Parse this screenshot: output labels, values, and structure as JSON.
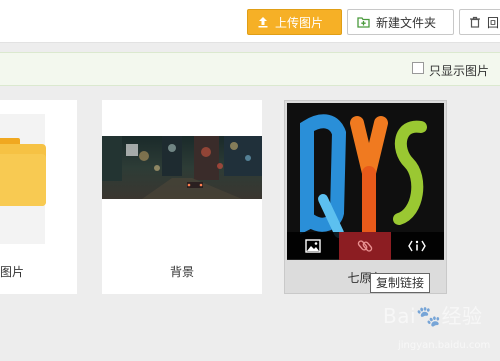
{
  "toolbar": {
    "upload_label": "上传图片",
    "new_folder_label": "新建文件夹",
    "more_label": "回"
  },
  "filter": {
    "show_images_only_label": "只显示图片",
    "show_images_only_checked": false
  },
  "cards": [
    {
      "name": "图片",
      "kind": "folder"
    },
    {
      "name": "背景",
      "kind": "image"
    },
    {
      "name": "七原色",
      "kind": "image",
      "thumb_letters": [
        "Q",
        "Y",
        "S"
      ]
    }
  ],
  "hover_actions": {
    "tooltip": "复制链接",
    "icons": [
      "image-icon",
      "link-icon",
      "info-icon"
    ]
  },
  "watermark": {
    "brand": "Bai",
    "suffix": "经验",
    "sub": "jingyan.baidu.com"
  },
  "colors": {
    "accent": "#f6b026",
    "filter_bar": "#f3f8ee",
    "active_action": "#8c1d22"
  }
}
